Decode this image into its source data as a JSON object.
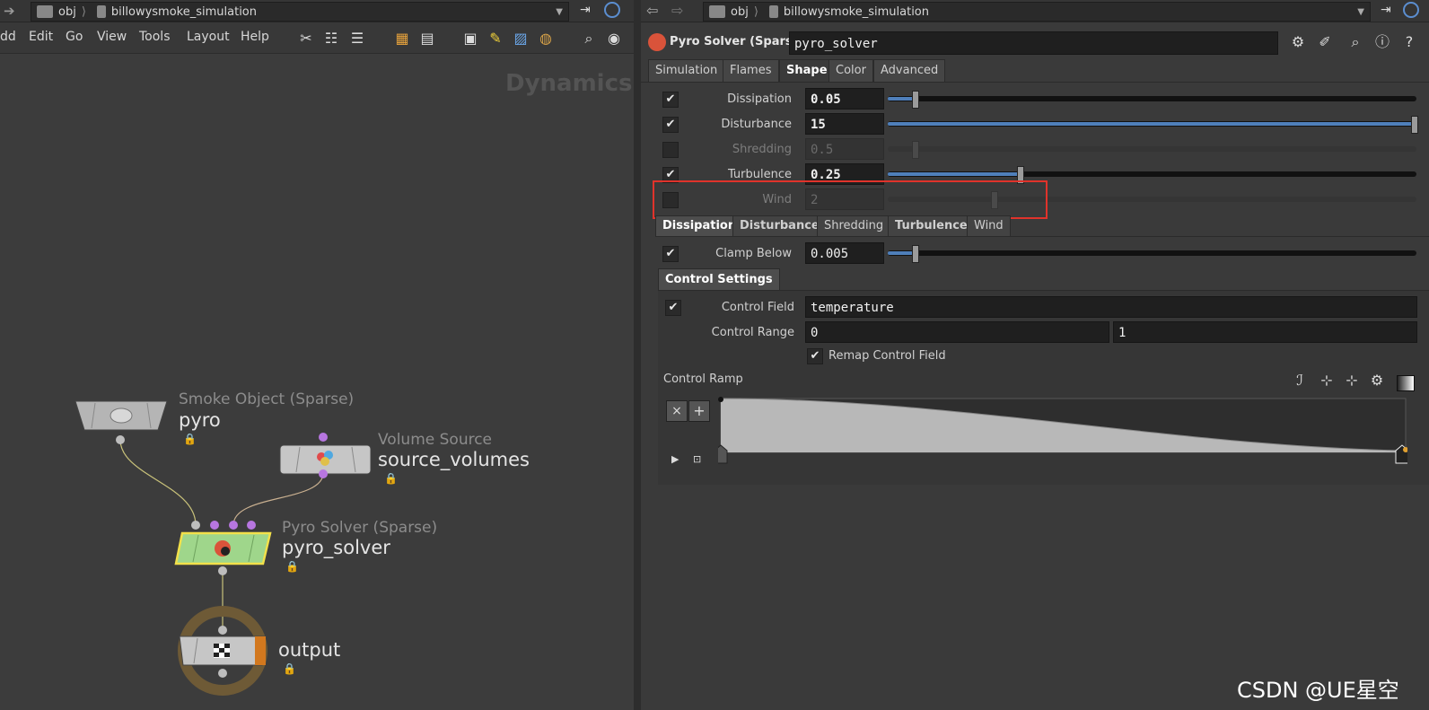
{
  "left": {
    "path": {
      "root": "obj",
      "network": "billowysmoke_simulation"
    },
    "menu": [
      "dd",
      "Edit",
      "Go",
      "View",
      "Tools",
      "Layout",
      "Help"
    ],
    "context_label": "Dynamics",
    "nodes": {
      "smoke": {
        "type": "Smoke Object (Sparse)",
        "name": "pyro"
      },
      "volume": {
        "type": "Volume Source",
        "name": "source_volumes"
      },
      "solver": {
        "type": "Pyro Solver (Sparse)",
        "name": "pyro_solver"
      },
      "output": {
        "name": "output"
      }
    },
    "lock_glyph": "🔒"
  },
  "right": {
    "path": {
      "root": "obj",
      "network": "billowysmoke_simulation"
    },
    "node_type": "Pyro Solver (Sparse)",
    "node_name": "pyro_solver",
    "tabs": [
      "Simulation",
      "Flames",
      "Shape",
      "Color",
      "Advanced"
    ],
    "active_tab": "Shape",
    "params": [
      {
        "label": "Dissipation",
        "value": "0.05",
        "checked": true,
        "slider": 0.05
      },
      {
        "label": "Disturbance",
        "value": "15",
        "checked": true,
        "slider": 1.0
      },
      {
        "label": "Shredding",
        "value": "0.5",
        "checked": false,
        "slider": 0.05
      },
      {
        "label": "Turbulence",
        "value": "0.25",
        "checked": true,
        "slider": 0.25
      },
      {
        "label": "Wind",
        "value": "2",
        "checked": false,
        "slider": 0.2
      }
    ],
    "subtabs": [
      "Dissipation",
      "Disturbance",
      "Shredding",
      "Turbulence",
      "Wind"
    ],
    "active_subtab": "Dissipation",
    "clamp": {
      "label": "Clamp Below",
      "value": "0.005",
      "checked": true
    },
    "control_settings_label": "Control Settings",
    "control_field": {
      "label": "Control Field",
      "value": "temperature"
    },
    "control_range": {
      "label": "Control Range",
      "min": "0",
      "max": "1"
    },
    "remap": {
      "label": "Remap Control Field",
      "checked": true
    },
    "ramp_label": "Control Ramp",
    "ramp_buttons": {
      "delete": "×",
      "add": "+"
    },
    "check_glyph": "✔"
  },
  "watermark": "CSDN @UE星空",
  "colors": {
    "highlight": "#e0332b",
    "solver_node": "#9fd68b",
    "output_ring": "#6e5a36"
  }
}
